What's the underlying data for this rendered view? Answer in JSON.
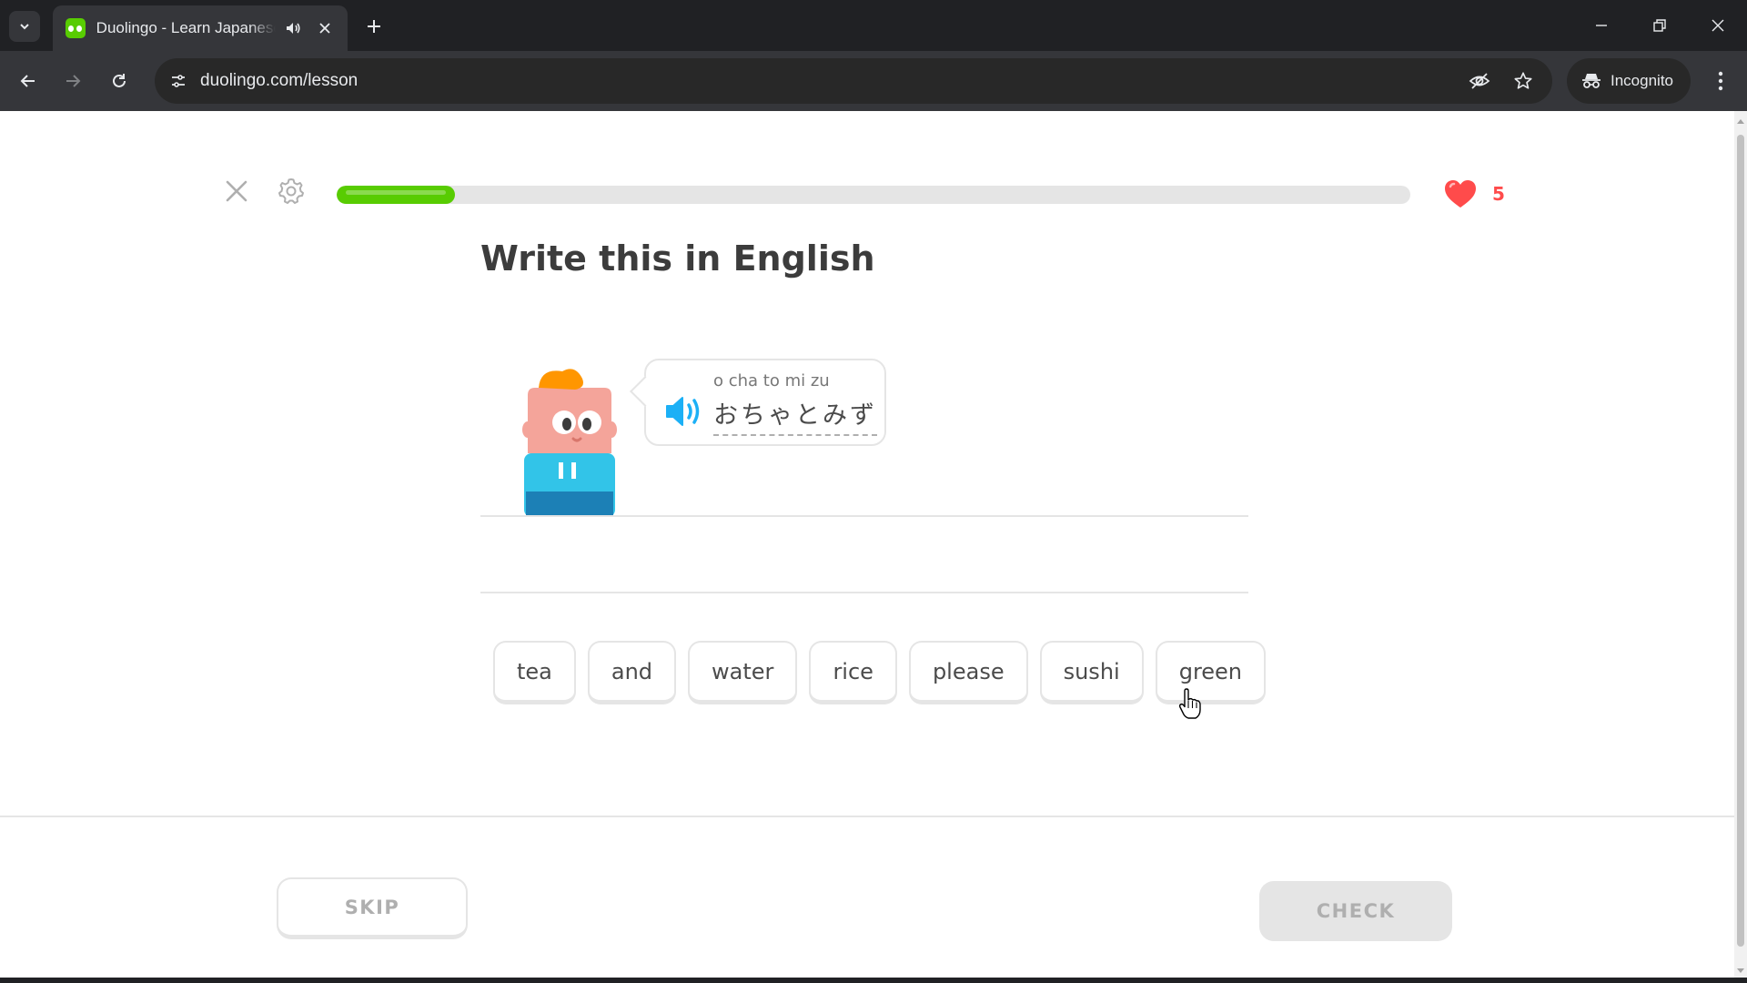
{
  "browser": {
    "tab": {
      "title": "Duolingo - Learn Japanese",
      "favicon": "duolingo-owl-icon",
      "audio_icon": "speaker-icon",
      "close_icon": "close-icon"
    },
    "new_tab_icon": "plus-icon",
    "window_controls": [
      "minimize-icon",
      "restore-icon",
      "close-icon"
    ],
    "nav": [
      "back-arrow-icon",
      "forward-arrow-icon",
      "reload-icon"
    ],
    "url": "duolingo.com/lesson",
    "omnibox_icons": [
      "eye-slash-icon",
      "star-icon"
    ],
    "incognito_label": "Incognito",
    "menu_icon": "kebab-menu-icon"
  },
  "lesson": {
    "progress": 0.11,
    "hearts": "5",
    "title": "Write this in English",
    "prompt": {
      "romaji": "o  cha  to mi zu",
      "kana": "おちゃとみず"
    },
    "word_bank": [
      "tea",
      "and",
      "water",
      "rice",
      "please",
      "sushi",
      "green"
    ],
    "skip_label": "SKIP",
    "check_label": "CHECK"
  },
  "colors": {
    "brand_green": "#58cc02",
    "heart_red": "#ff4b4b",
    "border_gray": "#e5e5e5",
    "text_dark": "#3c3c3c",
    "speaker_blue": "#1cb0f6"
  }
}
